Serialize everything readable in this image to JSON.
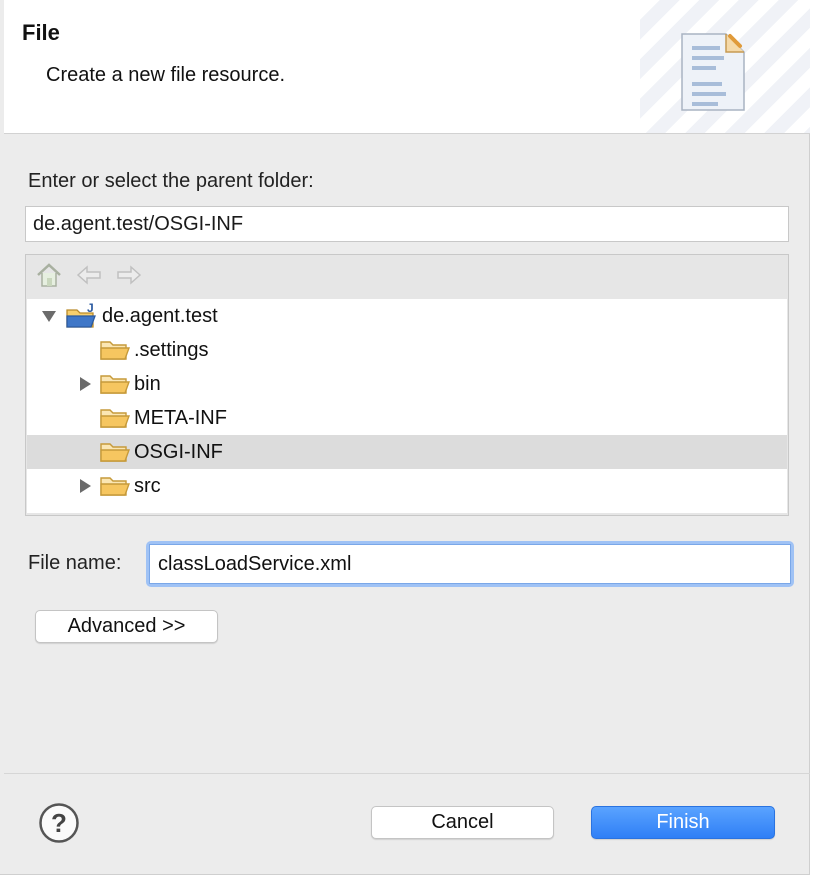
{
  "banner": {
    "title": "File",
    "description": "Create a new file resource."
  },
  "parent_folder": {
    "label": "Enter or select the parent folder:",
    "value": "de.agent.test/OSGI-INF"
  },
  "tree": {
    "items": [
      {
        "label": "de.agent.test",
        "twisty": "expanded",
        "selected": false
      },
      {
        "label": ".settings",
        "twisty": "none",
        "selected": false
      },
      {
        "label": "bin",
        "twisty": "collapsed",
        "selected": false
      },
      {
        "label": "META-INF",
        "twisty": "none",
        "selected": false
      },
      {
        "label": "OSGI-INF",
        "twisty": "none",
        "selected": true
      },
      {
        "label": "src",
        "twisty": "collapsed",
        "selected": false
      }
    ]
  },
  "file_name": {
    "label": "File name:",
    "value": "classLoadService.xml"
  },
  "buttons": {
    "advanced": "Advanced >>",
    "cancel": "Cancel",
    "finish": "Finish"
  },
  "colors": {
    "accent": "#2f7ff6",
    "selection": "#dcdcdc",
    "folder": "#f2b544"
  }
}
